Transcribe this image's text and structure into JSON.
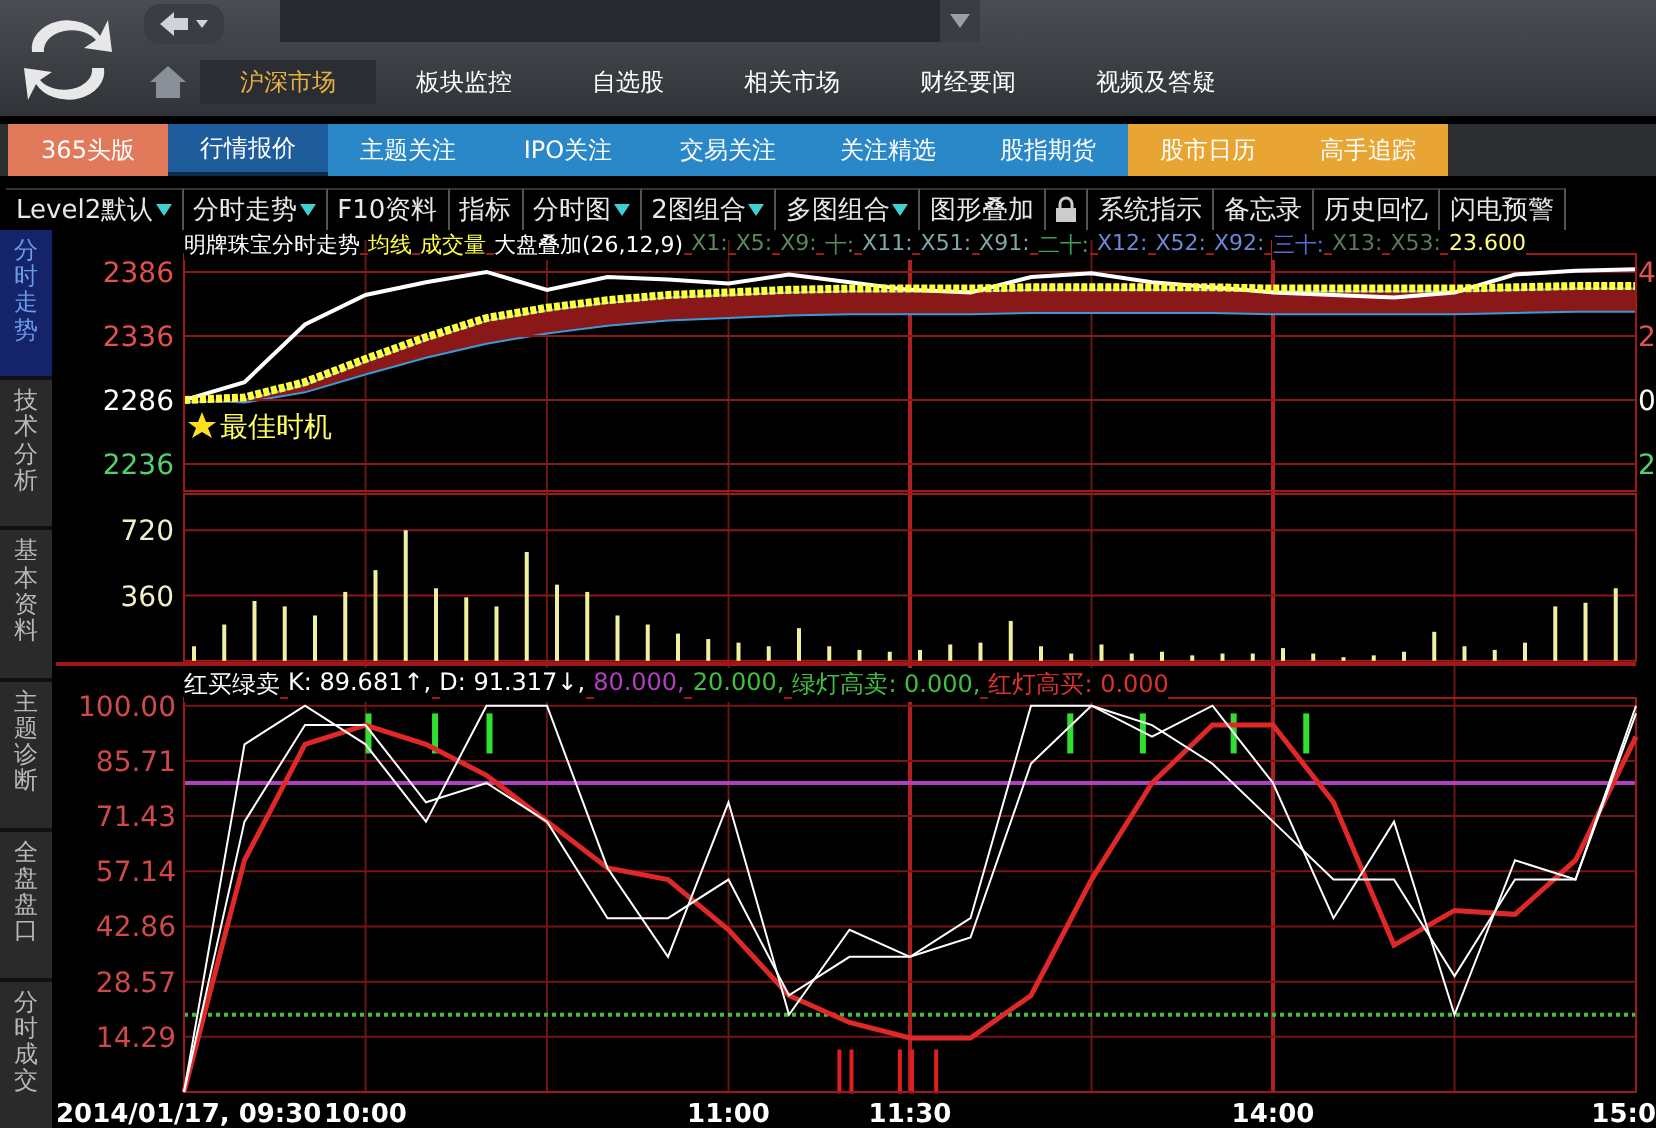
{
  "header": {
    "nav_tabs": [
      {
        "label": "沪深市场",
        "selected": true
      },
      {
        "label": "板块监控",
        "selected": false
      },
      {
        "label": "自选股",
        "selected": false
      },
      {
        "label": "相关市场",
        "selected": false
      },
      {
        "label": "财经要闻",
        "selected": false
      },
      {
        "label": "视频及答疑",
        "selected": false
      }
    ]
  },
  "menu_tabs": [
    {
      "label": "365头版",
      "color": "#e07a5a",
      "selected": false
    },
    {
      "label": "行情报价",
      "color": "#1f5c9c",
      "selected": true
    },
    {
      "label": "主题关注",
      "color": "#2a88c8",
      "selected": false
    },
    {
      "label": "IPO关注",
      "color": "#2a88c8",
      "selected": false
    },
    {
      "label": "交易关注",
      "color": "#2a88c8",
      "selected": false
    },
    {
      "label": "关注精选",
      "color": "#2a88c8",
      "selected": false
    },
    {
      "label": "股指期货",
      "color": "#2a88c8",
      "selected": false
    },
    {
      "label": "股市日历",
      "color": "#e8a533",
      "selected": false
    },
    {
      "label": "高手追踪",
      "color": "#e8a533",
      "selected": false
    }
  ],
  "toolbar": [
    {
      "kind": "dropdown",
      "label": "Level2默认"
    },
    {
      "kind": "dropdown",
      "label": "分时走势"
    },
    {
      "kind": "button",
      "label": "F10资料"
    },
    {
      "kind": "button",
      "label": "指标"
    },
    {
      "kind": "dropdown",
      "label": "分时图"
    },
    {
      "kind": "dropdown",
      "label": "2图组合"
    },
    {
      "kind": "dropdown",
      "label": "多图组合"
    },
    {
      "kind": "button",
      "label": "图形叠加"
    },
    {
      "kind": "lock"
    },
    {
      "kind": "button",
      "label": "系统指示"
    },
    {
      "kind": "button",
      "label": "备忘录"
    },
    {
      "kind": "button",
      "label": "历史回忆"
    },
    {
      "kind": "button",
      "label": "闪电预警"
    }
  ],
  "side_tabs": [
    {
      "label": "分时走势",
      "selected": true
    },
    {
      "label": "技术分析",
      "selected": false
    },
    {
      "label": "基本资料",
      "selected": false
    },
    {
      "label": "主题诊断",
      "selected": false
    },
    {
      "label": "全盘盘口",
      "selected": false
    },
    {
      "label": "分时成交",
      "selected": false
    }
  ],
  "legend": [
    {
      "text": "明牌珠宝分时走势",
      "color": "#ffffff"
    },
    {
      "text": "均线",
      "color": "#ffff40"
    },
    {
      "text": "成交量",
      "color": "#ffff40"
    },
    {
      "text": "大盘叠加(26,12,9)",
      "color": "#ffffff"
    },
    {
      "text": "X1:",
      "color": "#5a8a5a"
    },
    {
      "text": "X5:",
      "color": "#5a8a5a"
    },
    {
      "text": "X9:",
      "color": "#5a8a5a"
    },
    {
      "text": "十:",
      "color": "#5a8a5a"
    },
    {
      "text": "X11:",
      "color": "#7fa8a8"
    },
    {
      "text": "X51:",
      "color": "#7fa8a8"
    },
    {
      "text": "X91:",
      "color": "#7fa8a8"
    },
    {
      "text": "二十:",
      "color": "#3aa05a"
    },
    {
      "text": "X12:",
      "color": "#6a8ad8"
    },
    {
      "text": "X52:",
      "color": "#6a8ad8"
    },
    {
      "text": "X92:",
      "color": "#6a8ad8"
    },
    {
      "text": "三十:",
      "color": "#5a6ad8"
    },
    {
      "text": "X13:",
      "color": "#5a7a5a"
    },
    {
      "text": "X53:",
      "color": "#5a7a5a"
    },
    {
      "text": "23.600",
      "color": "#ffff80"
    }
  ],
  "price_chart": {
    "annotation": "最佳时机",
    "right_axis_labels": [
      "4",
      "2",
      "0",
      "2"
    ],
    "chart_data": {
      "type": "line",
      "grid": true,
      "categories": [
        null,
        null,
        null,
        null,
        null,
        null,
        null,
        null,
        null,
        null,
        null,
        null,
        null,
        null,
        null,
        null,
        null,
        null,
        null,
        null,
        null,
        null,
        null,
        null,
        null
      ],
      "ylim": [
        2215,
        2400
      ],
      "yticks": [
        2386,
        2336,
        2286,
        2236
      ],
      "series": [
        {
          "color": "#ffffff",
          "values": [
            2286,
            2300,
            2345,
            2368,
            2378,
            2386,
            2372,
            2382,
            2380,
            2377,
            2384,
            2378,
            2372,
            2370,
            2382,
            2385,
            2378,
            2374,
            2370,
            2368,
            2366,
            2370,
            2384,
            2387,
            2388
          ]
        },
        {
          "color": "#ffff40",
          "line_style": "dashed",
          "values": [
            2286,
            2288,
            2300,
            2318,
            2335,
            2350,
            2358,
            2364,
            2368,
            2370,
            2372,
            2373,
            2373,
            2373,
            2374,
            2374,
            2374,
            2374,
            2373,
            2373,
            2373,
            2373,
            2374,
            2375,
            2375
          ]
        }
      ]
    }
  },
  "volume_chart": {
    "chart_data": {
      "type": "bar",
      "grid": true,
      "categories": [
        null,
        null,
        null,
        null,
        null,
        null,
        null,
        null,
        null,
        null,
        null,
        null,
        null,
        null,
        null,
        null,
        null,
        null,
        null,
        null,
        null,
        null,
        null,
        null,
        null,
        null,
        null,
        null,
        null,
        null,
        null,
        null,
        null,
        null,
        null,
        null,
        null,
        null,
        null,
        null,
        null,
        null,
        null,
        null,
        null,
        null,
        null,
        null
      ],
      "ylim": [
        0,
        920
      ],
      "yticks": [
        720,
        360
      ],
      "values": [
        80,
        200,
        330,
        300,
        250,
        380,
        500,
        720,
        400,
        350,
        300,
        600,
        420,
        380,
        250,
        200,
        150,
        120,
        100,
        80,
        180,
        80,
        60,
        50,
        60,
        90,
        100,
        220,
        80,
        40,
        90,
        40,
        50,
        30,
        40,
        40,
        70,
        40,
        20,
        30,
        50,
        160,
        80,
        60,
        100,
        300,
        320,
        400
      ]
    }
  },
  "indicator_legend": [
    {
      "text": "红买绿卖",
      "color": "#ffffff"
    },
    {
      "text": "K: 89.681↑,",
      "color": "#ffffff"
    },
    {
      "text": "D: 91.317↓,",
      "color": "#ffffff"
    },
    {
      "text": "80.000,",
      "color": "#b040c0"
    },
    {
      "text": "20.000,",
      "color": "#40c040"
    },
    {
      "text": "绿灯高卖: 0.000,",
      "color": "#40c040"
    },
    {
      "text": "红灯高买: 0.000",
      "color": "#e03030"
    }
  ],
  "indicator_chart": {
    "chart_data": {
      "type": "line",
      "grid": true,
      "categories": [
        "2014/01/17, 09:30",
        null,
        null,
        "10:00",
        null,
        null,
        null,
        null,
        null,
        "11:00",
        null,
        null,
        "11:30",
        null,
        null,
        null,
        null,
        null,
        "14:00",
        null,
        null,
        null,
        null,
        null,
        "15:0"
      ],
      "ylim": [
        0,
        102
      ],
      "yticks": [
        {
          "value": 100,
          "label": "100.00"
        },
        {
          "value": 85.71,
          "label": "85.71"
        },
        {
          "value": 71.43,
          "label": "71.43"
        },
        {
          "value": 57.14,
          "label": "57.14"
        },
        {
          "value": 42.86,
          "label": "42.86"
        },
        {
          "value": 28.57,
          "label": "28.57"
        },
        {
          "value": 14.29,
          "label": "14.29"
        }
      ],
      "series": [
        {
          "color": "#e02828",
          "values": [
            0,
            60,
            90,
            95,
            90,
            82,
            70,
            58,
            55,
            42,
            25,
            18,
            14,
            14,
            25,
            55,
            80,
            95,
            95,
            75,
            38,
            47,
            46,
            60,
            92
          ]
        },
        {
          "color": "#ffffff",
          "values": [
            0,
            90,
            100,
            90,
            70,
            100,
            100,
            58,
            35,
            75,
            20,
            42,
            35,
            45,
            100,
            100,
            92,
            100,
            80,
            45,
            70,
            20,
            60,
            55,
            100
          ]
        },
        {
          "color": "#ffffff",
          "values": [
            0,
            70,
            95,
            95,
            75,
            80,
            70,
            45,
            45,
            55,
            25,
            35,
            35,
            40,
            85,
            100,
            95,
            85,
            70,
            55,
            55,
            30,
            55,
            55,
            98
          ]
        }
      ]
    }
  }
}
